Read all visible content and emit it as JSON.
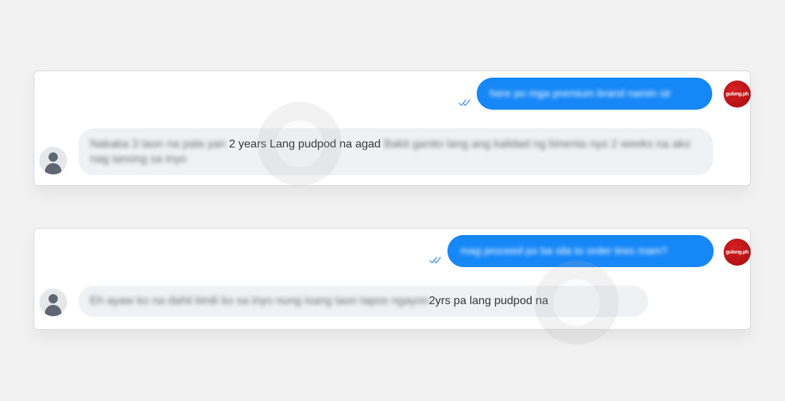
{
  "conversations": [
    {
      "outgoing": {
        "text": "here po mga premium brand namin sir",
        "sender_avatar": "gulong.ph",
        "status_icon": "double-check-icon"
      },
      "incoming": {
        "blurred_before": "Nakaka 3 taon na pala yan ",
        "clear_text": "2 years Lang pudpod na agad",
        "blurred_after": " Bakit ganito lang ang kalidad ng binenta nyo 2 weeks na ako nag tanong sa inyo",
        "avatar": "default-user-avatar-icon"
      }
    },
    {
      "outgoing": {
        "text": "mag proceed po ba sila to order tires mam?",
        "sender_avatar": "gulong.ph",
        "status_icon": "double-check-icon"
      },
      "incoming": {
        "blurred_before": "Eh ayaw ko na dahil binili ko sa inyo nung isang taon tapos ngayon ",
        "clear_text": "2yrs pa lang pudpod na",
        "blurred_after": "",
        "avatar": "default-user-avatar-icon"
      }
    }
  ],
  "colors": {
    "outgoing_bubble": "#1687f7",
    "incoming_bubble": "#f0f1f4",
    "brand_avatar": "#c5161c",
    "page_background": "#f2f2f2"
  }
}
